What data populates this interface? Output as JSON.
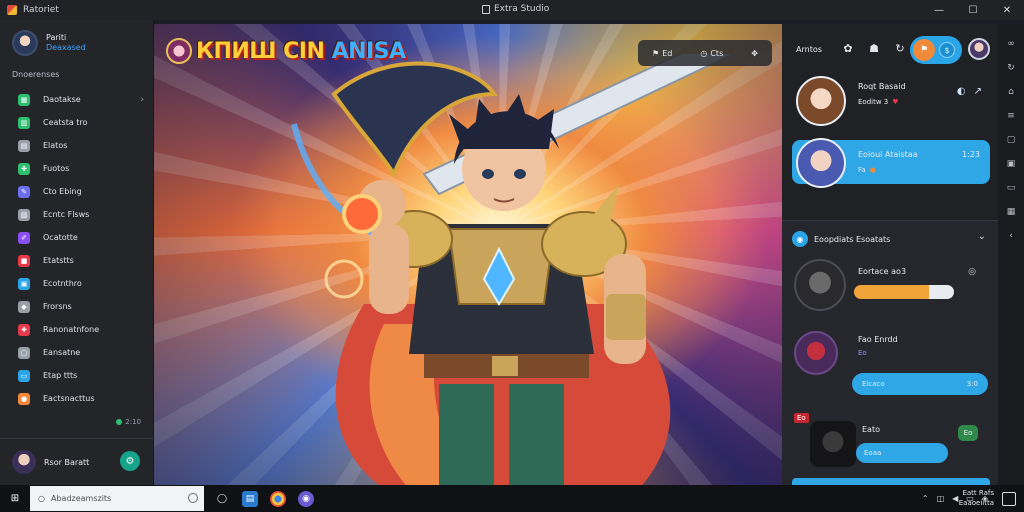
{
  "titlebar": {
    "app_name": "Ratoriet",
    "window_title": "Extra Studio",
    "minimize": "—",
    "maximize": "☐",
    "close": "✕"
  },
  "sidebar": {
    "profile": {
      "name": "Pariti",
      "subtitle": "Deaxased"
    },
    "section_label": "Dnoerenses",
    "items": [
      {
        "label": "Daotakse",
        "icon": "grid-icon",
        "color": "#2fbf71",
        "has_chevron": true
      },
      {
        "label": "Ceatsta tro",
        "icon": "chart-icon",
        "color": "#2fbf71"
      },
      {
        "label": "Elatos",
        "icon": "layers-icon",
        "color": "#9aa0aa"
      },
      {
        "label": "Fuotos",
        "icon": "puzzle-icon",
        "color": "#2fbf71"
      },
      {
        "label": "Cto Ebing",
        "icon": "pencil-icon",
        "color": "#6a6ff0"
      },
      {
        "label": "Ecntc Flsws",
        "icon": "folder-icon",
        "color": "#9aa0aa"
      },
      {
        "label": "Ocatotte",
        "icon": "brush-icon",
        "color": "#8a4ff0"
      },
      {
        "label": "Etatstts",
        "icon": "box-icon",
        "color": "#e83a4a"
      },
      {
        "label": "Ecotnthro",
        "icon": "film-icon",
        "color": "#2aa6e8"
      },
      {
        "label": "Frorsns",
        "icon": "gamepad-icon",
        "color": "#9aa0aa"
      },
      {
        "label": "Ranonatnfone",
        "icon": "puzzle-icon",
        "color": "#e83a4a"
      },
      {
        "label": "Eansatne",
        "icon": "image-icon",
        "color": "#9aa0aa"
      },
      {
        "label": "Etap ttts",
        "icon": "tablet-icon",
        "color": "#2aa6e8"
      },
      {
        "label": "Eactsnacttus",
        "icon": "palette-icon",
        "color": "#f08a3a"
      }
    ],
    "status": "2:10",
    "footer": {
      "name": "Rsor Baratt"
    }
  },
  "artwork": {
    "game_logo": "КПИШ CIN",
    "game_logo_accent": "ANISA",
    "tools": [
      "Ed",
      "Cts"
    ]
  },
  "right_panel": {
    "header": {
      "title": "Arntos"
    },
    "friends": [
      {
        "name": "Roqt Basaid",
        "meta": "Eoditw 3",
        "badge_icon": "heart-icon"
      },
      {
        "name": "Eoioui Ataistaa",
        "meta": "Fa",
        "time": "1:23"
      }
    ],
    "section": {
      "title": "Eoopdiats Esoatats",
      "cards": [
        {
          "title": "Eortace ao3",
          "progress": 0.75,
          "progress_label": "Fa"
        },
        {
          "title": "Fao Enrdd",
          "meta": "Eo",
          "bar_left": "Eicaco",
          "bar_right": "3:0"
        },
        {
          "tag": "Eo",
          "title": "Eato",
          "bar_label": "Eoaa",
          "badge": "Eo"
        }
      ]
    }
  },
  "taskbar": {
    "search_placeholder": "Abadzeamszits",
    "clock_time": "Eatt Rafs",
    "clock_date": "Eaaoeiitta"
  }
}
